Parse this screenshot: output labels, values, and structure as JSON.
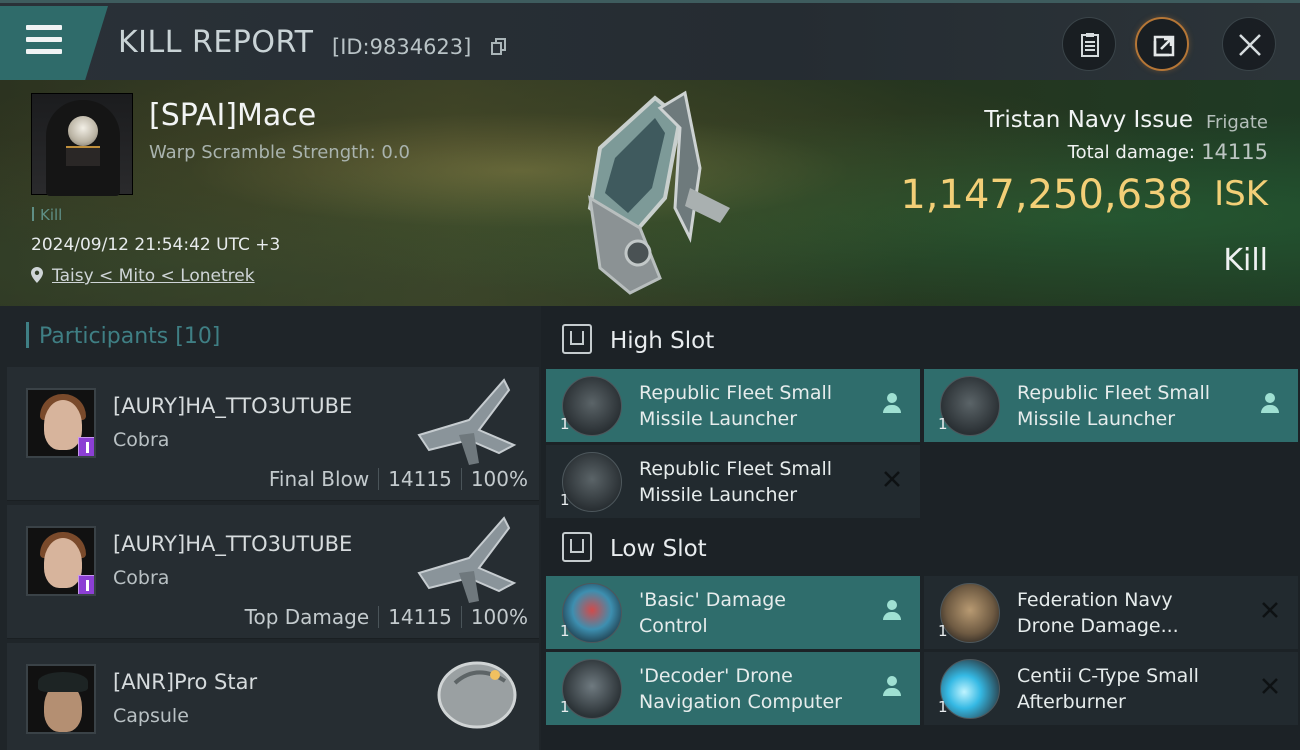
{
  "header": {
    "title": "KILL REPORT",
    "report_id": "[ID:9834623]",
    "icons": [
      "menu-icon",
      "copy-icon",
      "clipboard-icon",
      "share-icon",
      "close-icon"
    ]
  },
  "hero": {
    "pilot_name": "[SPAI]Mace",
    "warp_scramble": "Warp Scramble Strength: 0.0",
    "kill_tag": "Kill",
    "timestamp": "2024/09/12 21:54:42 UTC +3",
    "location": "Taisy < Mito < Lonetrek",
    "ship_name": "Tristan Navy Issue",
    "ship_class": "Frigate",
    "total_damage_label": "Total damage:",
    "total_damage": "14115",
    "isk_value": "1,147,250,638",
    "isk_label": "ISK",
    "result": "Kill"
  },
  "participants": {
    "label": "Participants",
    "count": "[10]",
    "rows": [
      {
        "name": "[AURY]HA_TTO3UTUBE",
        "ship": "Cobra",
        "role": "Final Blow",
        "damage": "14115",
        "percent": "100%"
      },
      {
        "name": "[AURY]HA_TTO3UTUBE",
        "ship": "Cobra",
        "role": "Top Damage",
        "damage": "14115",
        "percent": "100%"
      },
      {
        "name": "[ANR]Pro Star",
        "ship": "Capsule",
        "role": "",
        "damage": "",
        "percent": ""
      }
    ]
  },
  "slots": {
    "high": {
      "label": "High Slot",
      "modules": [
        {
          "name_line1": "Republic Fleet Small",
          "name_line2": "Missile Launcher",
          "qty": "1",
          "state": "fitted"
        },
        {
          "name_line1": "Republic Fleet Small",
          "name_line2": "Missile Launcher",
          "qty": "1",
          "state": "fitted"
        },
        {
          "name_line1": "Republic Fleet Small",
          "name_line2": "Missile Launcher",
          "qty": "1",
          "state": "destroyed"
        }
      ]
    },
    "low": {
      "label": "Low Slot",
      "modules": [
        {
          "name_line1": "'Basic' Damage",
          "name_line2": "Control",
          "qty": "1",
          "state": "fitted"
        },
        {
          "name_line1": "Federation Navy",
          "name_line2": "Drone Damage...",
          "qty": "1",
          "state": "destroyed"
        },
        {
          "name_line1": "'Decoder' Drone",
          "name_line2": "Navigation Computer",
          "qty": "1",
          "state": "fitted"
        },
        {
          "name_line1": "Centii C-Type Small",
          "name_line2": "Afterburner",
          "qty": "1",
          "state": "destroyed"
        }
      ]
    }
  },
  "colors": {
    "accent_teal": "#2f6d6c",
    "isk_gold": "#f3cf77",
    "header_bg": "#2a3138",
    "role_badge": "#8c3fd4"
  }
}
